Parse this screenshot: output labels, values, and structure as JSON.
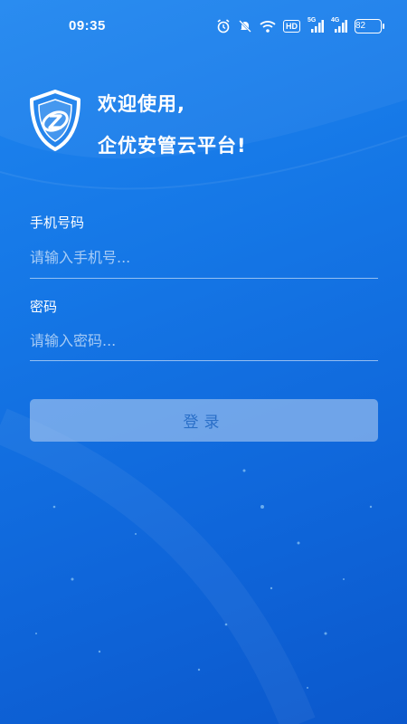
{
  "status_bar": {
    "time": "09:35",
    "icons": [
      "alarm-icon",
      "mute-icon",
      "wifi-icon",
      "hd-icon",
      "signal-5g-icon",
      "signal-4g-icon",
      "battery-icon"
    ],
    "hd": "HD",
    "net1": "5G",
    "net2": "4G",
    "battery": "82"
  },
  "header": {
    "logo": "shield-logo",
    "line1": "欢迎使用,",
    "line2": "企优安管云平台!"
  },
  "form": {
    "phone_label": "手机号码",
    "phone_placeholder": "请输入手机号...",
    "phone_value": "",
    "password_label": "密码",
    "password_placeholder": "请输入密码...",
    "password_value": "",
    "login_label": "登录"
  },
  "colors": {
    "background_top": "#1f86f0",
    "background_bottom": "#0b58cc",
    "button_bg": "#aac8f0",
    "button_text": "#2a6fc8"
  }
}
